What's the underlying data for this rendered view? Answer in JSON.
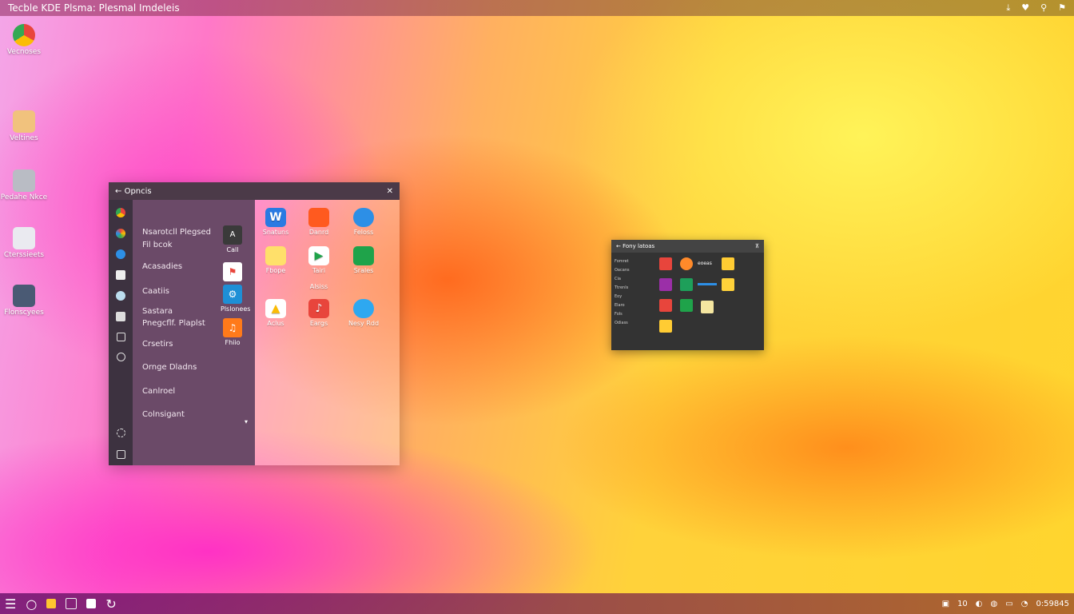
{
  "topbar": {
    "title": "Tecble KDE Plsma: Plesmal Imdeleis",
    "tray_icons": [
      "download-icon",
      "heart-icon",
      "pin-icon",
      "flag-icon"
    ]
  },
  "desktop_icons": [
    {
      "label": "Vecnoses",
      "icon": "chrome-icon",
      "color": "#e8453c"
    },
    {
      "label": "Veltines",
      "icon": "paint-icon",
      "color": "#f1c27d"
    },
    {
      "label": "Pedahe Nkce",
      "icon": "drive-icon",
      "color": "#b9bcc4"
    },
    {
      "label": "Cterssieets",
      "icon": "document-icon",
      "color": "#eaeaf0"
    },
    {
      "label": "Flonscyees",
      "icon": "film-icon",
      "color": "#4a5a74"
    }
  ],
  "launcher": {
    "title": "Opncis",
    "categories": [
      "Nsarotcll Plegsed",
      "Fil bcok",
      "Acasadies",
      "Caatiis",
      "Sastara",
      "Pnegcflf. Plaplst",
      "Crsetirs",
      "Ornge Dladns",
      "Canlroel",
      "Colnsigant"
    ],
    "pinned": [
      {
        "label": "Call",
        "icon": "a-letter-icon",
        "color": "#3a3a3a"
      },
      {
        "label": "",
        "icon": "flag-doc-icon",
        "color": "#ffffff"
      },
      {
        "label": "Plslonees",
        "icon": "gear-blue-icon",
        "color": "#1e8fd6"
      },
      {
        "label": "Fhiio",
        "icon": "headphones-icon",
        "color": "#ff7a1a"
      }
    ],
    "apps": [
      {
        "label": "Snatuns",
        "icon": "w-icon",
        "color": "#2a7ae2",
        "glyph": "W"
      },
      {
        "label": "Danrd",
        "icon": "toolbox-icon",
        "color": "#ff5a1f",
        "glyph": ""
      },
      {
        "label": "Feloss",
        "icon": "cloud-icon",
        "color": "#2d8fe6",
        "glyph": ""
      },
      {
        "label": "Fbope",
        "icon": "notes-icon",
        "color": "#ffe06a",
        "glyph": ""
      },
      {
        "label": "Tairi",
        "icon": "play-icon",
        "color": "#ffffff",
        "glyph": ""
      },
      {
        "label": "Srales",
        "icon": "sheets-icon",
        "color": "#1fa34a",
        "glyph": ""
      },
      {
        "label": "Alsiss",
        "icon": "",
        "color": "",
        "glyph": ""
      },
      {
        "label": "Aclus",
        "icon": "drive-tri-icon",
        "color": "#ffffff",
        "glyph": ""
      },
      {
        "label": "Eargs",
        "icon": "music-icon",
        "color": "#e8453c",
        "glyph": ""
      },
      {
        "label": "Nesy Rdd",
        "icon": "bird-icon",
        "color": "#2ea8f0",
        "glyph": ""
      }
    ]
  },
  "mini_window": {
    "title": "Fony latoas",
    "list": [
      "Fomret",
      "Oacans",
      "Cia",
      "Ttrenls",
      "Eoy",
      "Elaro",
      "Fols",
      "Odiass"
    ],
    "tile_labels": [
      "eoeas",
      "",
      "",
      ""
    ],
    "tile_colors": [
      "#e8453c",
      "#ff8a2a",
      "#9b2fa8",
      "#1e9f5a",
      "#2d8fe6",
      "#ffd23a",
      "#e8453c",
      "#1fa34a",
      "#f5e6a0",
      "#ffcc33"
    ]
  },
  "taskbar": {
    "icons": [
      "menu-icon",
      "search-icon",
      "folder-icon",
      "clipboard-icon",
      "store-icon",
      "refresh-icon"
    ],
    "tray_text": [
      "10",
      "0:59845"
    ]
  }
}
